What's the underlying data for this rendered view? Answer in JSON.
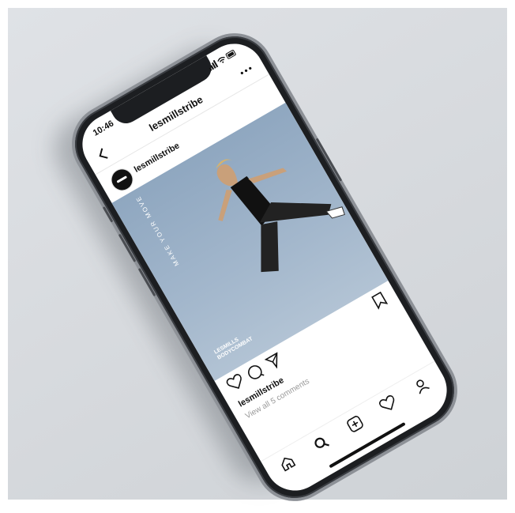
{
  "status_bar": {
    "time": "10:46",
    "icons": "signal wifi battery"
  },
  "header": {
    "title": "lesmillstribe",
    "back_icon": "chevron-left-icon",
    "more_icon": "more-horizontal-icon"
  },
  "post": {
    "username": "lesmillstribe",
    "image_tagline": "MAKE YOUR MOVE",
    "brand_line1": "LESMILLS",
    "brand_line2": "BODYCOMBAT",
    "likes_label": "lesmillstribe",
    "comments_label": "View all 5 comments"
  },
  "actions": {
    "like_icon": "heart-icon",
    "comment_icon": "comment-icon",
    "share_icon": "send-icon",
    "save_icon": "bookmark-icon"
  },
  "tabbar": {
    "items": [
      {
        "icon": "home-icon"
      },
      {
        "icon": "search-icon"
      },
      {
        "icon": "add-post-icon"
      },
      {
        "icon": "activity-heart-icon"
      },
      {
        "icon": "profile-icon"
      }
    ]
  },
  "colors": {
    "background": "#d6d9dd",
    "phone": "#1c1e21",
    "photo_sky": "#a3b7cc"
  }
}
